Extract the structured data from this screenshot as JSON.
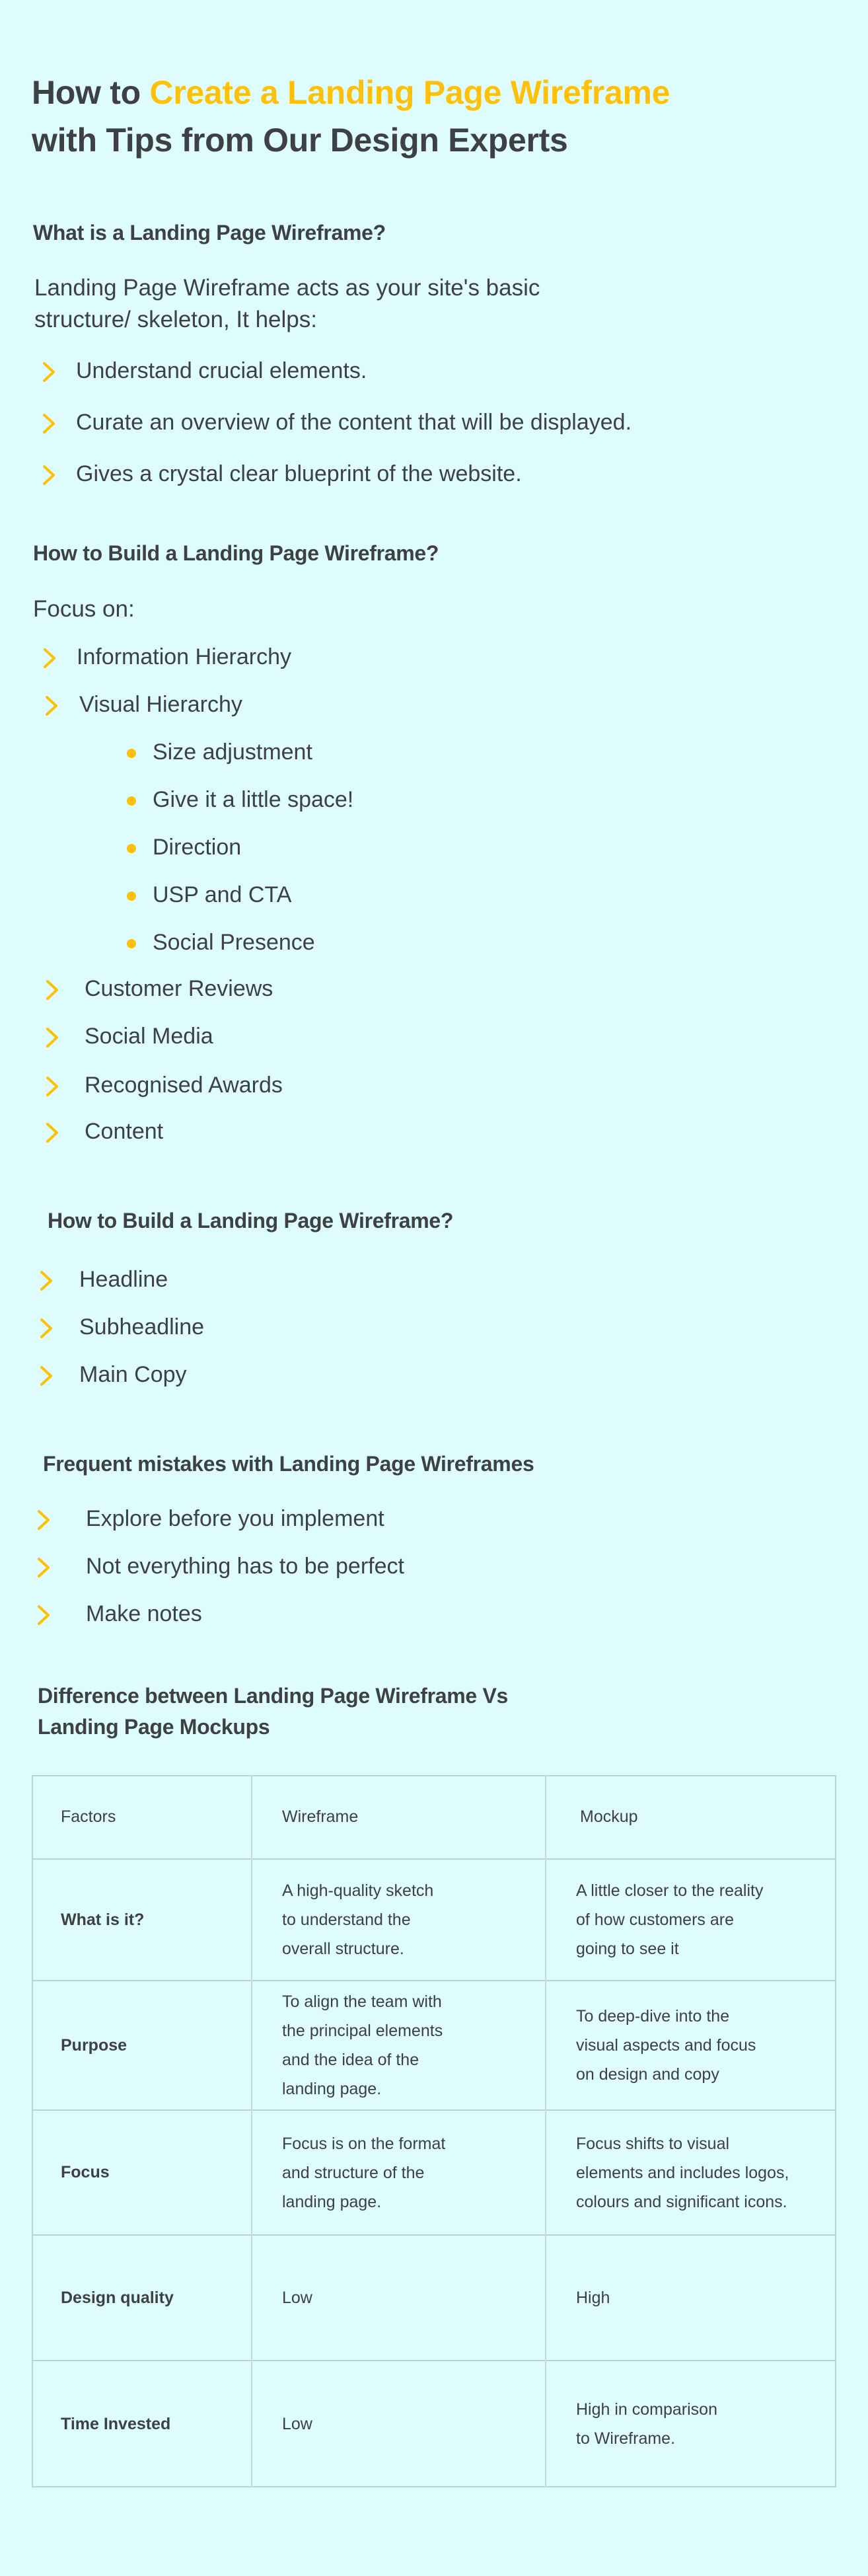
{
  "colors": {
    "background": "#dffcfc",
    "text": "#3d4044",
    "accent": "#ffc107",
    "table_border": "#b9d3d6"
  },
  "title": {
    "line1_prefix": "How to ",
    "line1_accent": "Create a Landing Page Wireframe",
    "line2": "with Tips from Our Design Experts"
  },
  "section1": {
    "heading": "What is a Landing Page Wireframe?",
    "intro_line1": "Landing Page Wireframe acts as your site's basic",
    "intro_line2": "structure/ skeleton, It helps:",
    "bullet_icon": "chevron-right-icon",
    "items": [
      "Understand crucial elements.",
      "Curate an overview of the content that will be displayed.",
      "Gives a crystal clear blueprint of the website."
    ]
  },
  "section2": {
    "heading": "How to Build a Landing Page Wireframe?",
    "intro": "Focus on:",
    "items": [
      "Information Hierarchy",
      "Visual Hierarchy"
    ],
    "sub_bullet_icon": "dot-icon",
    "sub_items": [
      "Size adjustment",
      "Give it a little space!",
      "Direction",
      "USP and CTA",
      "Social Presence"
    ],
    "more_items": [
      "Customer Reviews",
      "Social Media",
      "Recognised Awards",
      "Content"
    ]
  },
  "section3": {
    "heading": "How to Build a Landing Page Wireframe?",
    "items": [
      "Headline",
      "Subheadline",
      "Main Copy"
    ]
  },
  "section4": {
    "heading": "Frequent mistakes with Landing Page Wireframes",
    "items": [
      "Explore before you implement",
      "Not everything has to be perfect",
      "Make notes"
    ]
  },
  "section5": {
    "heading_line1": "Difference between Landing Page Wireframe Vs",
    "heading_line2": "Landing Page Mockups",
    "table": {
      "headers": [
        "Factors",
        "Wireframe",
        "Mockup"
      ],
      "rows": [
        {
          "factor": "What is it?",
          "wireframe": [
            "A high-quality sketch",
            "to understand the",
            "overall structure."
          ],
          "mockup": [
            "A little closer to the reality",
            "of how customers are",
            "going to see it"
          ]
        },
        {
          "factor": "Purpose",
          "wireframe": [
            "To align the team with",
            "the principal elements",
            "and the idea of the",
            "landing page."
          ],
          "mockup": [
            "To deep-dive into the",
            "visual aspects and focus",
            "on design and copy"
          ]
        },
        {
          "factor": "Focus",
          "wireframe": [
            "Focus is on the format",
            "and structure of the",
            "landing page."
          ],
          "mockup": [
            "Focus shifts to visual",
            "elements and includes logos,",
            "colours and significant icons."
          ]
        },
        {
          "factor": "Design quality",
          "wireframe": [
            "Low"
          ],
          "mockup": [
            "High"
          ]
        },
        {
          "factor": "Time Invested",
          "wireframe": [
            "Low"
          ],
          "mockup": [
            "High in comparison",
            "to Wireframe."
          ]
        }
      ]
    }
  }
}
